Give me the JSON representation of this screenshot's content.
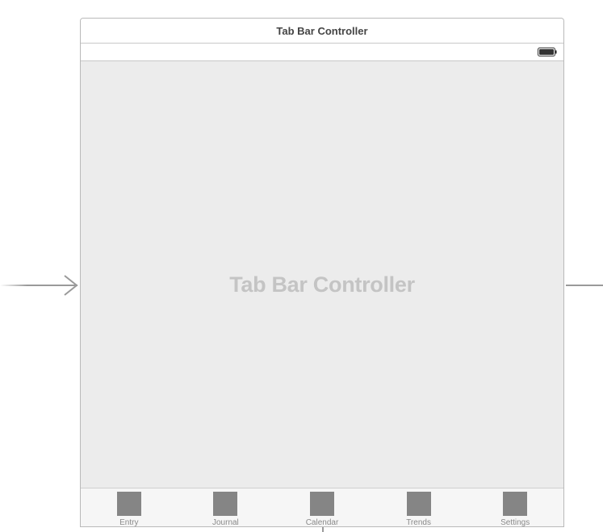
{
  "scene": {
    "title": "Tab Bar Controller",
    "watermark": "Tab Bar Controller"
  },
  "status_bar": {
    "battery_icon": "battery-full-icon"
  },
  "tab_bar": {
    "items": [
      {
        "label": "Entry",
        "icon": "placeholder-square-icon"
      },
      {
        "label": "Journal",
        "icon": "placeholder-square-icon"
      },
      {
        "label": "Calendar",
        "icon": "placeholder-square-icon"
      },
      {
        "label": "Trends",
        "icon": "placeholder-square-icon"
      },
      {
        "label": "Settings",
        "icon": "placeholder-square-icon"
      }
    ]
  },
  "colors": {
    "canvas_bg": "#ffffff",
    "scene_bg": "#ececec",
    "tab_icon": "#858585",
    "connector": "#9a9a9a"
  }
}
